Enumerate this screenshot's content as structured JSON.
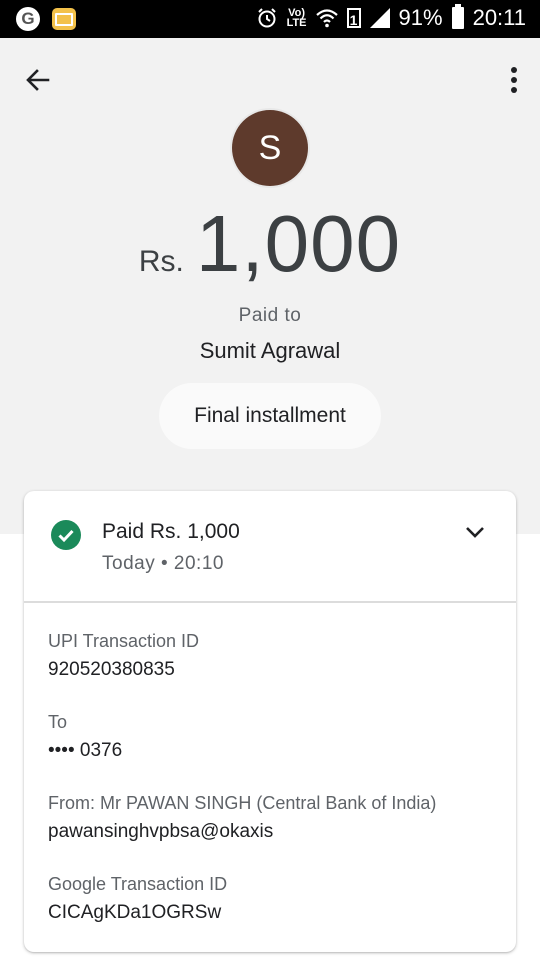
{
  "status_bar": {
    "battery": "91%",
    "time": "20:11",
    "volte_top": "Vo)",
    "volte_bottom": "LTE",
    "sim": "1"
  },
  "payment": {
    "avatar_letter": "S",
    "currency": "Rs.",
    "amount": "1,000",
    "paid_to_label": "Paid to",
    "payee": "Sumit Agrawal",
    "note": "Final installment"
  },
  "details": {
    "status_title": "Paid Rs. 1,000",
    "status_time": "Today • 20:10",
    "upi_label": "UPI Transaction ID",
    "upi_value": "920520380835",
    "to_label": "To",
    "to_value": "•••• 0376",
    "from_label": "From: Mr PAWAN  SINGH (Central Bank of India)",
    "from_value": "pawansinghvpbsa@okaxis",
    "google_label": "Google Transaction ID",
    "google_value": "CICAgKDa1OGRSw"
  },
  "colors": {
    "success_green": "#1b8a5a",
    "avatar_brown": "#5e3a2c"
  },
  "icons": [
    "google-icon",
    "message-icon",
    "alarm-icon",
    "wifi-icon",
    "signal-icon",
    "battery-icon",
    "back-arrow-icon",
    "more-vert-icon",
    "check-circle-icon",
    "chevron-down-icon"
  ]
}
